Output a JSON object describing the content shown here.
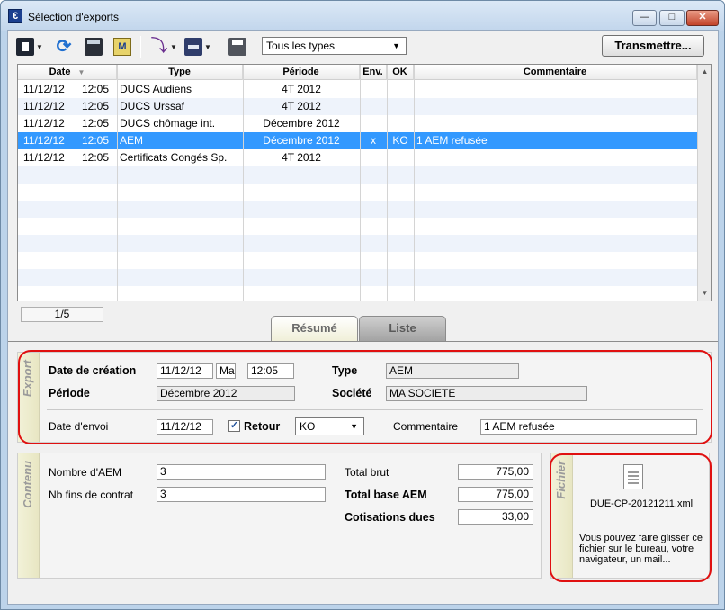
{
  "window": {
    "title": "Sélection d'exports",
    "app_icon_glyph": "€",
    "minimize_glyph": "—",
    "maximize_glyph": "□",
    "close_glyph": "✕"
  },
  "toolbar": {
    "type_filter": "Tous les types",
    "transmit_label": "Transmettre...",
    "icons": [
      "export-icon",
      "refresh-icon",
      "calculator-icon",
      "mail-icon",
      "import-icon",
      "transfer-icon",
      "print-icon"
    ]
  },
  "grid": {
    "columns": [
      "Date",
      "Type",
      "Période",
      "Env.",
      "OK",
      "Commentaire"
    ],
    "rows": [
      {
        "date": "11/12/12",
        "time": "12:05",
        "type": "DUCS Audiens",
        "periode": "4T 2012",
        "env": "",
        "ok": "",
        "commentaire": ""
      },
      {
        "date": "11/12/12",
        "time": "12:05",
        "type": "DUCS Urssaf",
        "periode": "4T 2012",
        "env": "",
        "ok": "",
        "commentaire": ""
      },
      {
        "date": "11/12/12",
        "time": "12:05",
        "type": "DUCS chômage int.",
        "periode": "Décembre 2012",
        "env": "",
        "ok": "",
        "commentaire": ""
      },
      {
        "date": "11/12/12",
        "time": "12:05",
        "type": "AEM",
        "periode": "Décembre 2012",
        "env": "x",
        "ok": "KO",
        "commentaire": "1 AEM refusée"
      },
      {
        "date": "11/12/12",
        "time": "12:05",
        "type": "Certificats Congés Sp.",
        "periode": "4T 2012",
        "env": "",
        "ok": "",
        "commentaire": ""
      }
    ],
    "selected_row": 3,
    "counter": "1/5"
  },
  "tabs": {
    "resume": "Résumé",
    "liste": "Liste"
  },
  "export": {
    "section_label": "Export",
    "date_creation_label": "Date de création",
    "date_creation": "11/12/12",
    "day": "Ma",
    "time": "12:05",
    "type_label": "Type",
    "type": "AEM",
    "periode_label": "Période",
    "periode": "Décembre 2012",
    "societe_label": "Société",
    "societe": "MA SOCIETE",
    "date_envoi_label": "Date d'envoi",
    "date_envoi": "11/12/12",
    "retour_label": "Retour",
    "retour_checked": "✓",
    "retour_value": "KO",
    "commentaire_label": "Commentaire",
    "commentaire": "1 AEM refusée"
  },
  "contenu": {
    "section_label": "Contenu",
    "nb_aem_label": "Nombre d'AEM",
    "nb_aem": "3",
    "nb_fins_label": "Nb fins de contrat",
    "nb_fins": "3",
    "total_brut_label": "Total brut",
    "total_brut": "775,00",
    "total_base_label": "Total base AEM",
    "total_base": "775,00",
    "cotisations_label": "Cotisations dues",
    "cotisations": "33,00"
  },
  "fichier": {
    "section_label": "Fichier",
    "filename": "DUE-CP-20121211.xml",
    "hint": "Vous pouvez faire glisser ce fichier sur le bureau, votre navigateur, un mail..."
  }
}
